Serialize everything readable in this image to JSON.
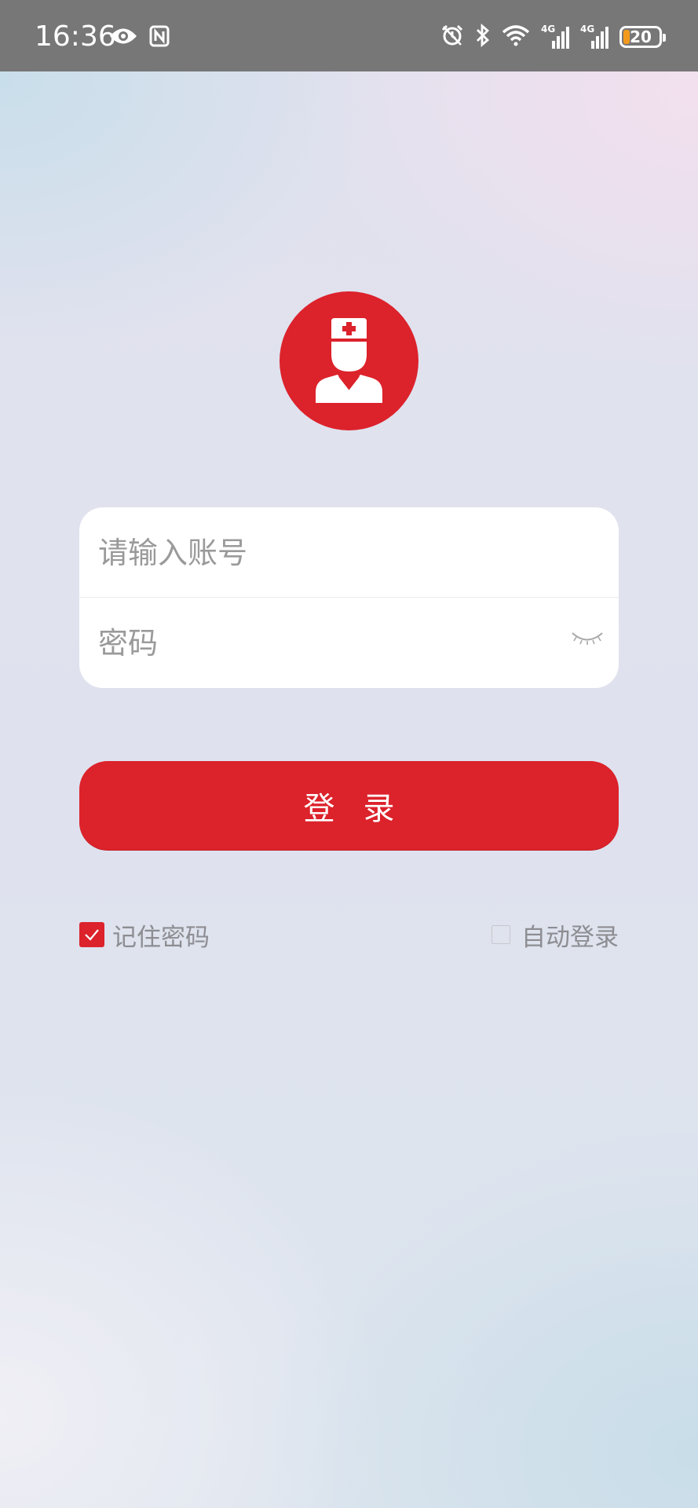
{
  "status_bar": {
    "time": "16:36",
    "network_1": "4G",
    "network_2": "4G",
    "battery": "20",
    "icons": [
      "eye-icon",
      "nfc-icon",
      "alarm-icon",
      "bluetooth-icon",
      "wifi-icon",
      "signal-icon",
      "battery-icon"
    ]
  },
  "avatar": {
    "icon": "doctor-avatar-icon",
    "color": "#dc222b"
  },
  "form": {
    "account_placeholder": "请输入账号",
    "account_value": "",
    "password_placeholder": "密码",
    "password_value": "",
    "password_toggle_icon": "eye-closed-icon"
  },
  "login_button": {
    "label": "登录",
    "color": "#dc222b"
  },
  "options": {
    "remember_password": {
      "label": "记住密码",
      "checked": true
    },
    "auto_login": {
      "label": "自动登录",
      "checked": false
    }
  }
}
